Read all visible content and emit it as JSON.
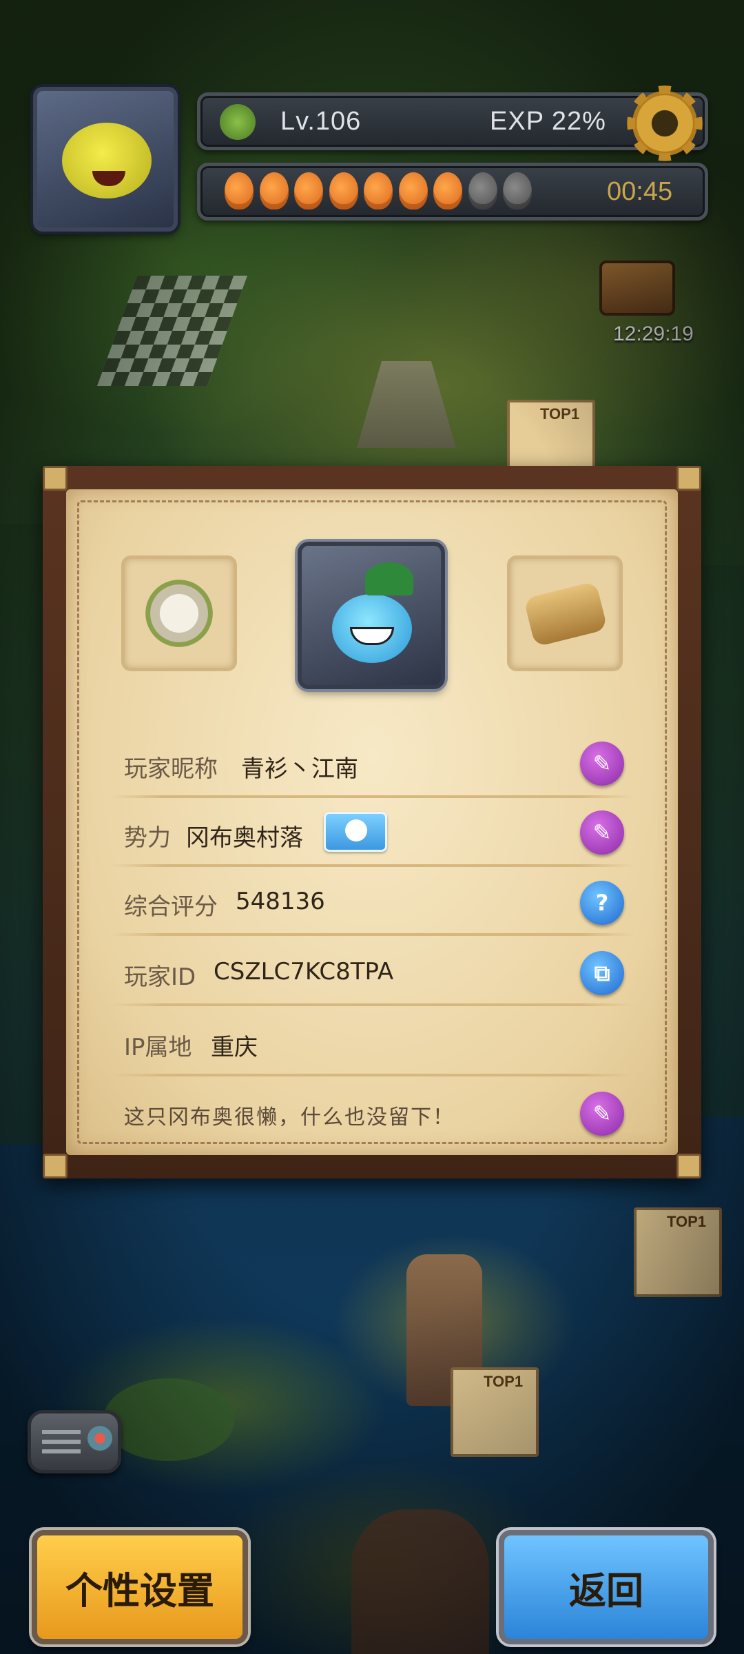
{
  "hud": {
    "level": "Lv.106",
    "exp": "EXP 22%",
    "stamina_timer": "00:45",
    "stamina": {
      "filled": 7,
      "total": 9
    }
  },
  "map": {
    "chest_timer": "12:29:19",
    "rank_badge": "TOP1"
  },
  "profile": {
    "rows": [
      {
        "label": "玩家昵称",
        "value": "青衫丶江南",
        "action": "edit"
      },
      {
        "label": "势力",
        "value": "冈布奥村落",
        "action": "edit"
      },
      {
        "label": "综合评分",
        "value": "548136",
        "action": "help"
      },
      {
        "label": "玩家ID",
        "value": "CSZLC7KC8TPA",
        "action": "copy"
      },
      {
        "label": "IP属地",
        "value": "重庆"
      }
    ],
    "motto": "这只冈布奥很懒，什么也没留下！"
  },
  "buttons": {
    "personalize": "个性设置",
    "back": "返回"
  },
  "colors": {
    "edit_seal": "#a23cc0",
    "info_seal": "#2a7ee0",
    "orange_button": "#f2b02e",
    "blue_button": "#3f98e6"
  }
}
